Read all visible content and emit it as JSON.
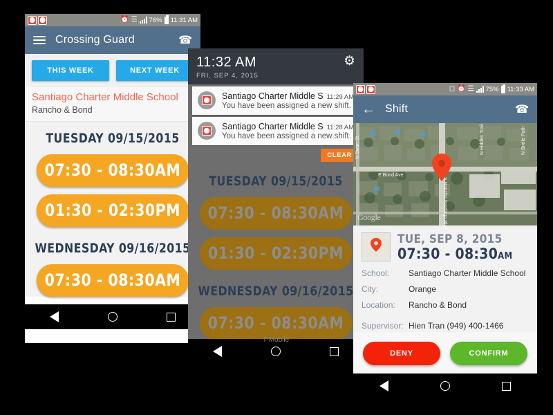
{
  "phone1": {
    "status": {
      "time": "11:31 AM",
      "battery": "76%",
      "icons": [
        "stop-notification",
        "stop-notification",
        "alarm",
        "usb",
        "signal",
        "battery"
      ]
    },
    "appbar": {
      "title": "Crossing Guard",
      "menu_icon": "hamburger-icon",
      "phone_icon": "phone-icon"
    },
    "tabs": [
      {
        "label": "THIS WEEK"
      },
      {
        "label": "NEXT WEEK"
      }
    ],
    "school": {
      "name": "Santiago Charter Middle School",
      "location": "Rancho & Bond"
    },
    "schedule": [
      {
        "day": "TUESDAY 09/15/2015",
        "slots": [
          "07:30 - 08:30AM",
          "01:30 - 02:30PM"
        ]
      },
      {
        "day": "WEDNESDAY 09/16/2015",
        "slots": [
          "07:30 - 08:30AM"
        ]
      }
    ]
  },
  "phone2": {
    "shade": {
      "time": "11:32 AM",
      "date": "FRI, SEP 4, 2015",
      "gear_icon": "gear-icon"
    },
    "notifications": [
      {
        "title": "Santiago Charter Middle Scho",
        "time": "11:29 AM",
        "text": "You have been assigned a new shift. For qu"
      },
      {
        "title": "Santiago Charter Middle Scho",
        "time": "11:28 AM",
        "text": "You have been assigned a new shift. For qu"
      }
    ],
    "clear_label": "CLEAR",
    "schedule": [
      {
        "day": "TUESDAY 09/15/2015",
        "slots": [
          "07:30 - 08:30AM",
          "01:30 - 02:30PM"
        ]
      },
      {
        "day": "WEDNESDAY 09/16/2015",
        "slots": [
          "07:30 - 08:30AM"
        ]
      }
    ],
    "carrier": "T-Mobile"
  },
  "phone3": {
    "status": {
      "time": "11:33 AM",
      "battery": "75%"
    },
    "appbar": {
      "title": "Shift",
      "back_icon": "back-arrow-icon",
      "phone_icon": "phone-icon"
    },
    "map": {
      "watermark": "Google",
      "streets": [
        "N Swan St",
        "E Bond Ave",
        "S Rancho Santiago Blvd",
        "N Hidden Trail",
        "N Bridle Path"
      ],
      "marker": "map-pin"
    },
    "detail": {
      "date": "TUE, SEP 8, 2015",
      "time": "07:30 - 08:30",
      "time_suffix": "AM",
      "fields": [
        {
          "key": "School:",
          "value": "Santiago Charter Middle School"
        },
        {
          "key": "City:",
          "value": "Orange"
        },
        {
          "key": "Location:",
          "value": "Rancho & Bond"
        }
      ],
      "supervisor": {
        "key": "Supervisor:",
        "value": "Hien Tran (949) 400-1466"
      }
    },
    "actions": [
      {
        "label": "DENY"
      },
      {
        "label": "CONFIRM"
      }
    ]
  },
  "colors": {
    "accent_orange": "#f5a623",
    "blue": "#26a9e8",
    "appbar": "#52708c",
    "deny": "#f32208",
    "confirm": "#5cb82a",
    "school_red": "#f2654c"
  }
}
